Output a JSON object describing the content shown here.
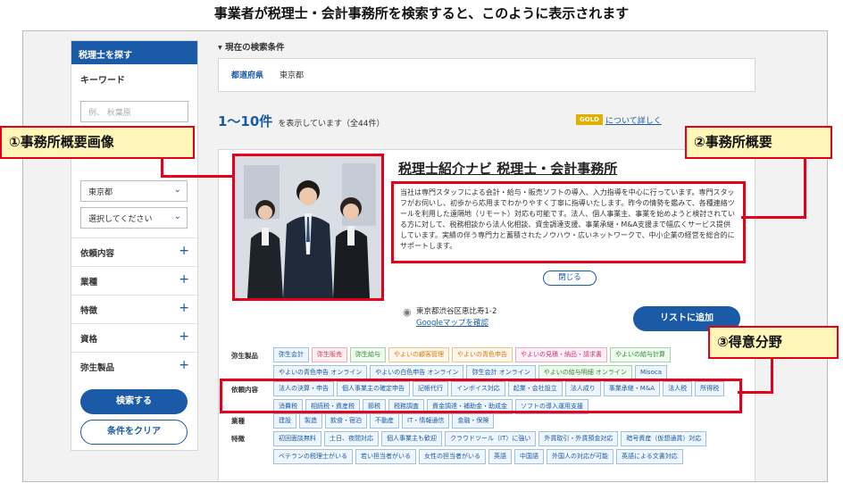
{
  "caption": "事業者が税理士・会計事務所を検索すると、このように表示されます",
  "sidebar": {
    "header": "税理士を探す",
    "keyword_label": "キーワード",
    "keyword_placeholder": "例、 秋葉原",
    "pref_value": "東京都",
    "city_value": "選択してください",
    "accordions": [
      "依頼内容",
      "業種",
      "特徴",
      "資格",
      "弥生製品"
    ],
    "search_button": "検索する",
    "clear_button": "条件をクリア"
  },
  "conditions": {
    "heading": "現在の検索条件",
    "key": "都道府県",
    "value": "東京都"
  },
  "results": {
    "range": "1〜10件",
    "suffix": "を表示しています（全44件）",
    "gold": "GOLD",
    "gold_link": "について詳しく"
  },
  "office": {
    "title": "税理士紹介ナビ 税理士・会計事務所",
    "description": "当社は専門スタッフによる会計・給与・販売ソフトの導入、入力指導を中心に行っています。専門スタッフがお伺いし、初歩から応用までわかりやすく丁寧に指導いたします。昨今の情勢を鑑みて、各種連絡ツールを利用した遠隔地（リモート）対応も可能です。法人、個人事業主、事業を始めようと検討されている方に対して、税務相談から法人化相談、資金調達支援、事業承継・M&A支援まで幅広くサービス提供しています。実績の伴う専門力と蓄積されたノウハウ・広いネットワークで、中小企業の経営を総合的にサポートします。",
    "close": "閉じる",
    "address": "東京都渋谷区恵比寿1-2",
    "map_link": "Googleマップを確認",
    "list_button": "リストに追加"
  },
  "tag_groups": {
    "yayoi_label": "弥生製品",
    "yayoi": [
      {
        "t": "弥生会計",
        "c": ""
      },
      {
        "t": "弥生販売",
        "c": "r"
      },
      {
        "t": "弥生給与",
        "c": "g"
      },
      {
        "t": "やよいの顧客管理",
        "c": "o"
      },
      {
        "t": "やよいの青色申告",
        "c": "o"
      },
      {
        "t": "やよいの見積・納品・請求書",
        "c": "p"
      },
      {
        "t": "やよいの給与計算",
        "c": "g"
      },
      {
        "t": "やよいの青色申告 オンライン",
        "c": ""
      },
      {
        "t": "やよいの白色申告 オンライン",
        "c": ""
      },
      {
        "t": "弥生会計 オンライン",
        "c": ""
      },
      {
        "t": "やよいの給与明細 オンライン",
        "c": "g"
      },
      {
        "t": "Misoca",
        "c": ""
      }
    ],
    "request_label": "依頼内容",
    "request": [
      "法人の決算・申告",
      "個人事業主の確定申告",
      "記帳代行",
      "インボイス対応",
      "起業・会社設立",
      "法人成り",
      "事業承継・M&A",
      "法人税",
      "所得税",
      "消費税",
      "相続税・資産税",
      "節税",
      "税務調査",
      "資金調達・補助金・助成金",
      "ソフトの導入運用支援"
    ],
    "industry_label": "業種",
    "industry": [
      "建設",
      "製造",
      "飲食・宿泊",
      "不動産",
      "IT・情報通信",
      "金融・保険"
    ],
    "feature_label": "特徴",
    "features": [
      "初回面談無料",
      "土日、夜間対応",
      "個人事業主も歓迎",
      "クラウドツール（IT）に強い",
      "外貨取引・外貨預金対応",
      "暗号資産（仮想通貨）対応",
      "ベテランの税理士がいる",
      "若い担当者がいる",
      "女性の担当者がいる",
      "英語",
      "中国語",
      "外国人の対応が可能",
      "英語による文書対応"
    ]
  },
  "callouts": {
    "c1": "①事務所概要画像",
    "c2": "②事務所概要",
    "c3": "③得意分野"
  },
  "colors": {
    "accent": "#1b5aa6",
    "highlight": "#e4001b",
    "callout_bg": "#fff6b8"
  }
}
